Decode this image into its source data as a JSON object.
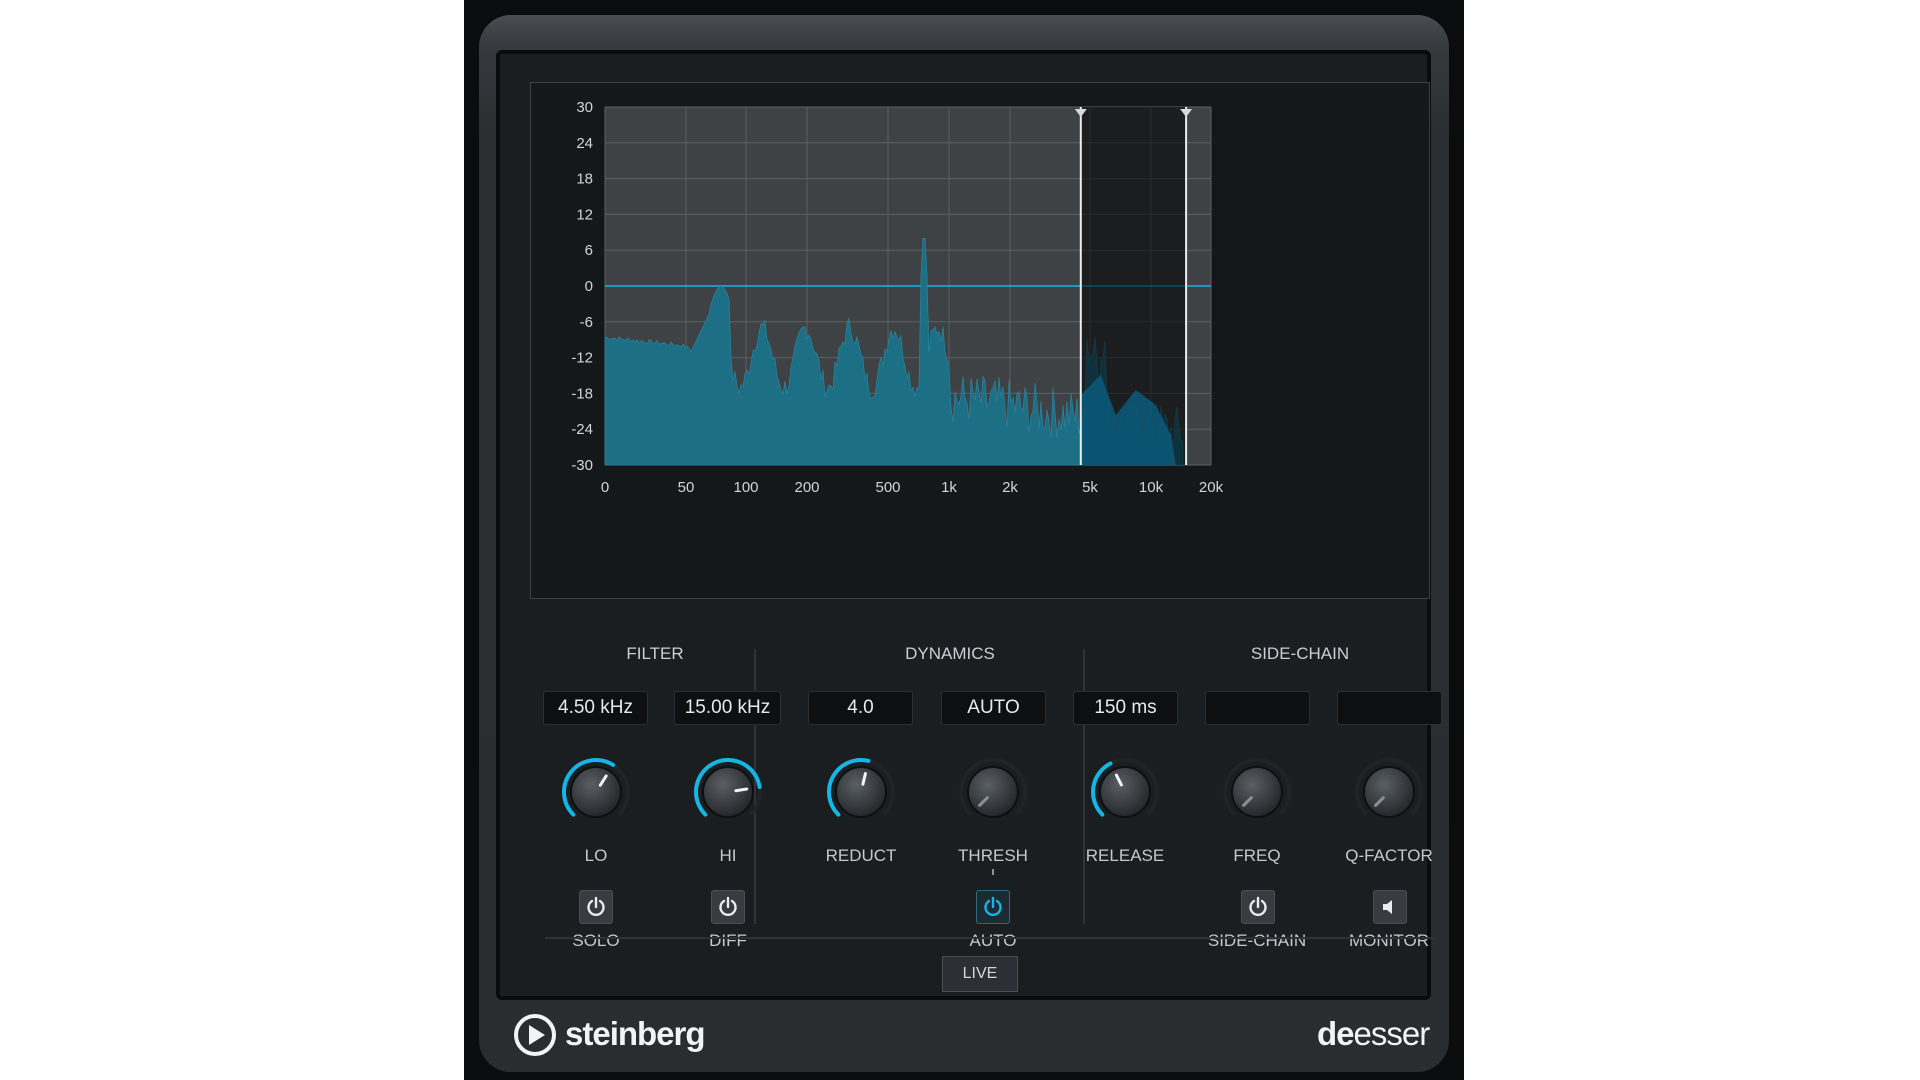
{
  "brand": {
    "name": "steinberg",
    "product_prefix": "de",
    "product_suffix": "esser"
  },
  "colors": {
    "accent": "#14b6e6",
    "spectrum_fill": "#1d6f86",
    "spectrum_band": "#0a5a7a",
    "grid": "#5c6063"
  },
  "analyzer": {
    "y_ticks": [
      "30",
      "24",
      "18",
      "12",
      "6",
      "0",
      "-6",
      "-12",
      "-18",
      "-24",
      "-30"
    ],
    "x_ticks": [
      "0",
      "50",
      "100",
      "200",
      "500",
      "1k",
      "2k",
      "5k",
      "10k",
      "20k"
    ],
    "band_lo_hz": 4500,
    "band_hi_hz": 15000,
    "threshold_db": 0
  },
  "sections": {
    "filter": "FILTER",
    "dynamics": "DYNAMICS",
    "sidechain": "SIDE-CHAIN"
  },
  "filter": {
    "lo": {
      "value": "4.50 kHz",
      "label": "LO",
      "level": 0.62
    },
    "hi": {
      "value": "15.00 kHz",
      "label": "HI",
      "level": 0.8
    },
    "solo_label": "SOLO",
    "diff_label": "DIFF"
  },
  "dynamics": {
    "reduct": {
      "value": "4.0",
      "label": "REDUCT",
      "level": 0.55
    },
    "thresh": {
      "value": "AUTO",
      "label": "THRESH",
      "level": 0.0
    },
    "release": {
      "value": "150 ms",
      "label": "RELEASE",
      "level": 0.4
    },
    "auto_label": "AUTO"
  },
  "sidechain": {
    "freq": {
      "value": "",
      "label": "FREQ",
      "level": 0.0
    },
    "qfactor": {
      "value": "",
      "label": "Q-FACTOR",
      "level": 0.0
    },
    "sidechain_label": "SIDE-CHAIN",
    "monitor_label": "MONITOR"
  },
  "live_label": "LIVE",
  "icons": {
    "power": "power-icon",
    "speaker": "speaker-icon",
    "logo": "steinberg-logo-icon"
  }
}
